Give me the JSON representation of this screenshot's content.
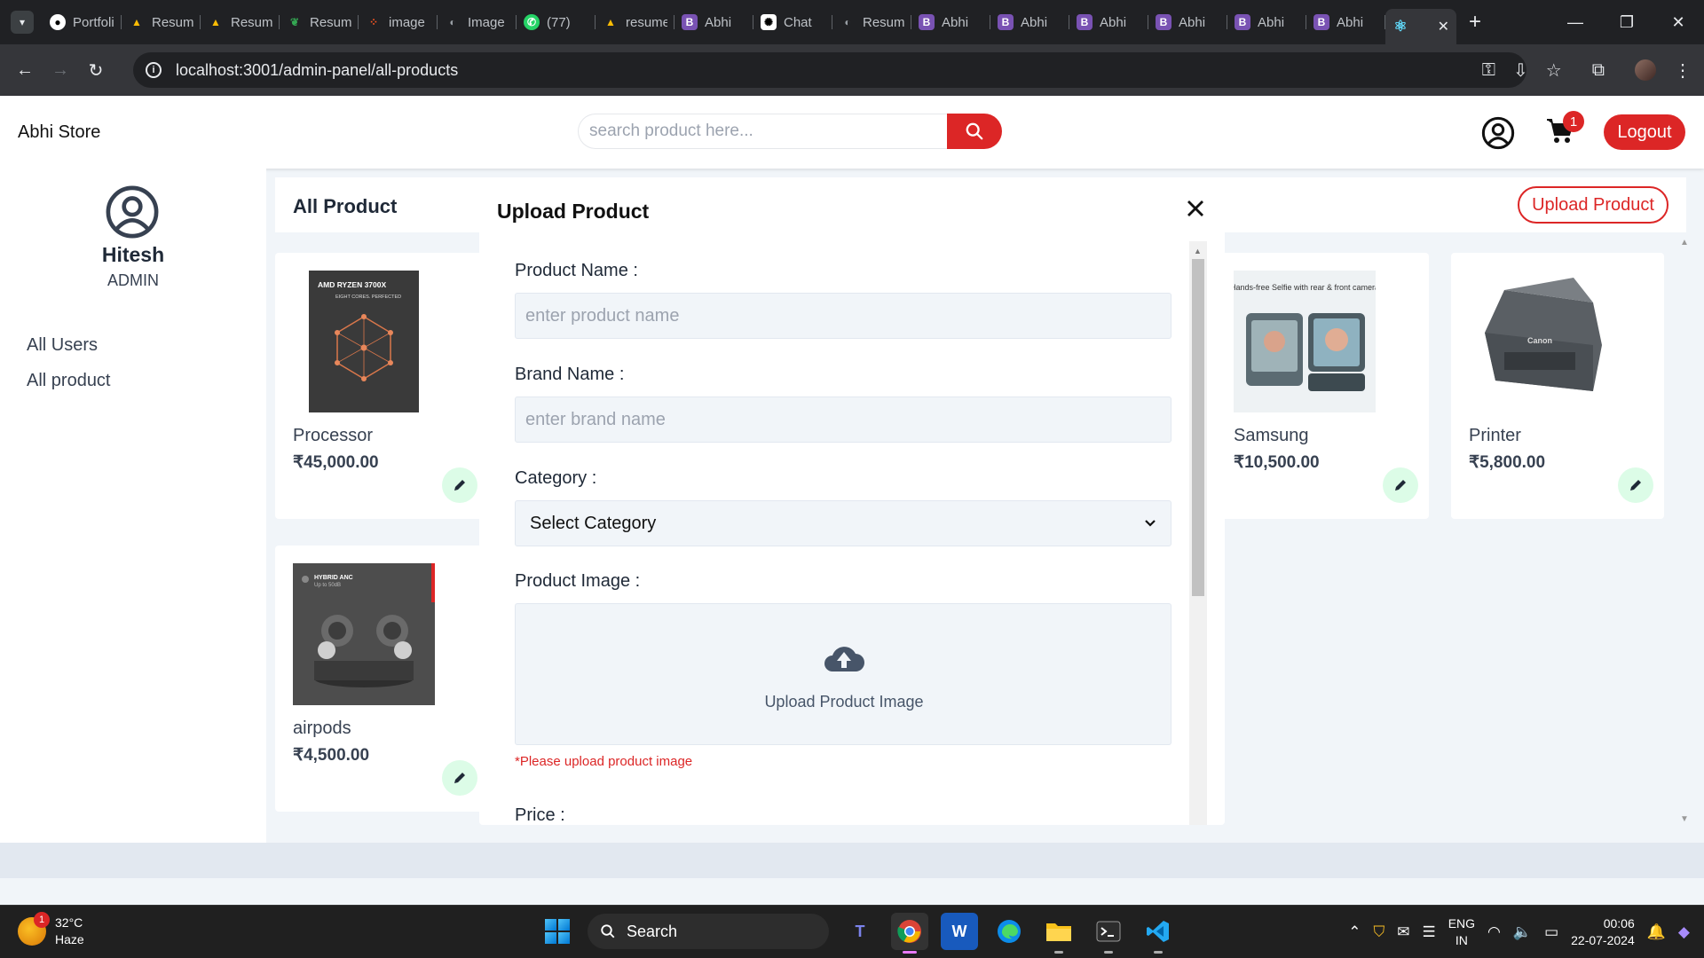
{
  "browser": {
    "tabs": [
      {
        "title": "Portfolio",
        "icon": "github-icon",
        "color": "#ffffff"
      },
      {
        "title": "Resume",
        "icon": "google-drive-icon",
        "color": "#fbbc04"
      },
      {
        "title": "Resume",
        "icon": "google-drive-icon",
        "color": "#fbbc04"
      },
      {
        "title": "Resume",
        "icon": "leaf-icon",
        "color": "#34a853"
      },
      {
        "title": "image",
        "icon": "dots-icon",
        "color": "#ff5722"
      },
      {
        "title": "Image",
        "icon": "globe-icon",
        "color": "#9aa0a6"
      },
      {
        "title": "(77)",
        "icon": "whatsapp-icon",
        "color": "#25d366"
      },
      {
        "title": "resume",
        "icon": "google-drive-icon",
        "color": "#fbbc04"
      },
      {
        "title": "Abhi",
        "icon": "bootstrap-icon",
        "color": "#7952b3"
      },
      {
        "title": "Chat",
        "icon": "chatgpt-icon",
        "color": "#ffffff"
      },
      {
        "title": "Resume",
        "icon": "globe-icon",
        "color": "#9aa0a6"
      },
      {
        "title": "Abhi",
        "icon": "bootstrap-icon",
        "color": "#7952b3"
      },
      {
        "title": "Abhi",
        "icon": "bootstrap-icon",
        "color": "#7952b3"
      },
      {
        "title": "Abhi",
        "icon": "bootstrap-icon",
        "color": "#7952b3"
      },
      {
        "title": "Abhi",
        "icon": "bootstrap-icon",
        "color": "#7952b3"
      },
      {
        "title": "Abhi",
        "icon": "bootstrap-icon",
        "color": "#7952b3"
      },
      {
        "title": "Abhi",
        "icon": "bootstrap-icon",
        "color": "#7952b3"
      }
    ],
    "url": "localhost:3001/admin-panel/all-products"
  },
  "header": {
    "logo": "Abhi Store",
    "search_placeholder": "search product here...",
    "cart_count": "1",
    "logout_label": "Logout"
  },
  "sidebar": {
    "user_name": "Hitesh",
    "role": "ADMIN",
    "links": [
      "All Users",
      "All product"
    ]
  },
  "main": {
    "title": "All Product",
    "upload_button": "Upload Product",
    "products": [
      {
        "name": "Processor",
        "price": "₹45,000.00",
        "image_text": "AMD RYZEN 3700X",
        "image_sub": "EIGHT CORES. PERFECTED"
      },
      {
        "name": "Samsung",
        "price": "₹10,500.00",
        "image_text": "Hands-free Selfie with rear & front camera"
      },
      {
        "name": "Printer",
        "price": "₹5,800.00",
        "image_text": "Canon"
      },
      {
        "name": "airpods",
        "price": "₹4,500.00",
        "image_text": "HYBRID ANC",
        "image_sub": "Up to 50dB"
      }
    ]
  },
  "modal": {
    "title": "Upload Product",
    "product_name_label": "Product Name :",
    "product_name_placeholder": "enter product name",
    "brand_name_label": "Brand Name :",
    "brand_name_placeholder": "enter brand name",
    "category_label": "Category :",
    "category_selected": "Select Category",
    "image_label": "Product Image :",
    "upload_text": "Upload Product Image",
    "error_text": "*Please upload product image",
    "price_label": "Price :"
  },
  "taskbar": {
    "weather_badge": "1",
    "temperature": "32°C",
    "condition": "Haze",
    "search_label": "Search",
    "lang_top": "ENG",
    "lang_bottom": "IN",
    "time": "00:06",
    "date": "22-07-2024"
  },
  "colors": {
    "accent": "#dc2626",
    "edit_bg": "#dcfce7",
    "page_bg": "#f1f5f9"
  }
}
